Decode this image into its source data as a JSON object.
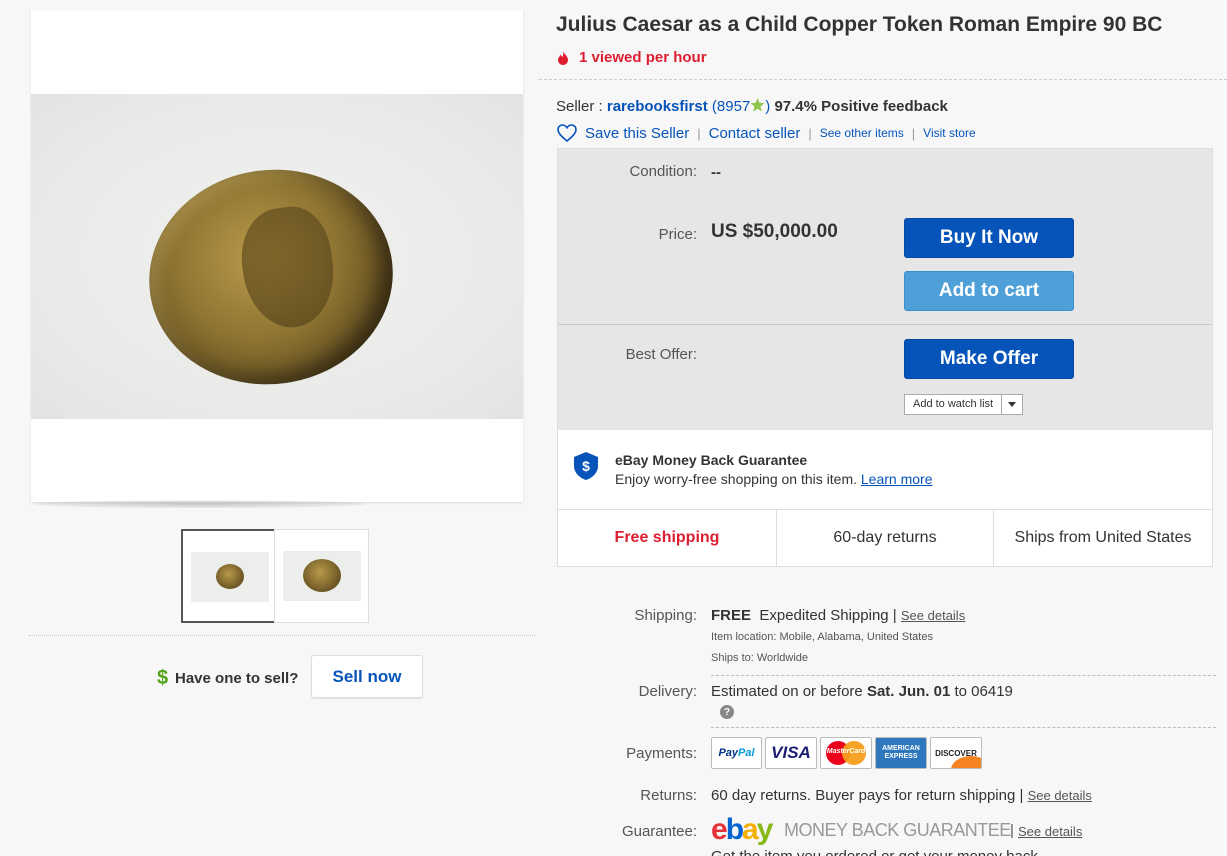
{
  "listing": {
    "title": "Julius Caesar as a Child Copper Token Roman Empire 90 BC",
    "viewed": "1 viewed per hour"
  },
  "seller": {
    "prefix": "Seller :",
    "name": "rarebooksfirst",
    "score_open": "(8957",
    "score_close": ")",
    "feedback": "97.4% Positive feedback",
    "save": "Save this Seller",
    "contact": "Contact seller",
    "see_items": "See other items",
    "visit_store": "Visit store"
  },
  "buy_box": {
    "condition_label": "Condition:",
    "condition_value": "--",
    "price_label": "Price:",
    "price_value": "US $50,000.00",
    "buy_now": "Buy It Now",
    "add_to_cart": "Add to cart",
    "best_offer_label": "Best Offer:",
    "make_offer": "Make Offer",
    "watch_list": "Add to watch list"
  },
  "guarantee_panel": {
    "title": "eBay Money Back Guarantee",
    "subtitle": "Enjoy worry-free shopping on this item.",
    "learn_more": "Learn more"
  },
  "highlights": [
    "Free shipping",
    "60-day returns",
    "Ships from United States"
  ],
  "details": {
    "shipping_label": "Shipping:",
    "shipping_free": "FREE",
    "shipping_method": "Expedited Shipping |",
    "see_details": "See details",
    "item_location": "Item location:  Mobile, Alabama, United States",
    "ships_to": "Ships to:  Worldwide",
    "delivery_label": "Delivery:",
    "delivery_prefix": "Estimated on or before",
    "delivery_date": "Sat. Jun. 01",
    "delivery_suffix": "to 06419",
    "payments_label": "Payments:",
    "returns_label": "Returns:",
    "returns_value": "60 day returns. Buyer pays for return shipping |",
    "guarantee_label": "Guarantee:",
    "mbg_text": "MONEY BACK GUARANTEE",
    "mbg_sep": "|",
    "cutoff_text": "Get the item you ordered or get your money back."
  },
  "payments": {
    "paypal_a": "Pay",
    "paypal_b": "Pal",
    "visa": "VISA",
    "mastercard": "MasterCard",
    "amex": "AMERICAN EXPRESS",
    "discover": "DISCOVER"
  },
  "ebay_logo": {
    "e": "e",
    "b": "b",
    "a": "a",
    "y": "y"
  },
  "sell": {
    "dollar": "$",
    "prompt": "Have one to sell?",
    "button": "Sell now"
  },
  "colors": {
    "link_blue": "#0654ba",
    "buy_blue": "#0654ba",
    "cart_blue": "#4f9fd9",
    "alert_red": "#dd1e31",
    "sell_green": "#53a318",
    "buy_box_bg": "#e6e6e6"
  },
  "icons": [
    "flame-icon",
    "star-icon",
    "heart-icon",
    "shield-icon",
    "help-icon",
    "caret-down-icon"
  ]
}
